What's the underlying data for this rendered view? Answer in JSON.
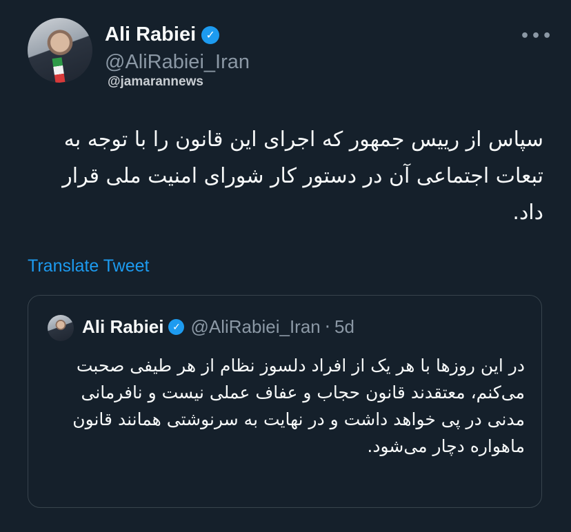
{
  "author": {
    "name": "Ali Rabiei",
    "handle": "@AliRabiei_Iran",
    "verified_glyph": "✓"
  },
  "watermark": "@jamarannews",
  "more_glyph": "•••",
  "tweet_text": "سپاس از رییس جمهور که اجرای این قانون را با توجه به تبعات اجتماعی آن در دستور کار شورای امنیت ملی قرار داد.",
  "translate_label": "Translate Tweet",
  "quoted": {
    "name": "Ali Rabiei",
    "handle": "@AliRabiei_Iran",
    "separator": "·",
    "time": "5d",
    "text": "در این روزها با هر یک از افراد دلسوز نظام از هر طیفی صحبت می‌کنم، معتقدند قانون حجاب و عفاف عملی نیست و نافرمانی مدنی در پی خواهد داشت و در نهایت به سرنوشتی همانند قانون ماهواره دچار می‌شود."
  },
  "colors": {
    "background": "#15202b",
    "accent": "#1d9bf0",
    "secondary_text": "#8b98a5",
    "border": "#38444d"
  },
  "icons": {
    "verified": "verified-badge-icon",
    "more": "more-options-icon"
  }
}
